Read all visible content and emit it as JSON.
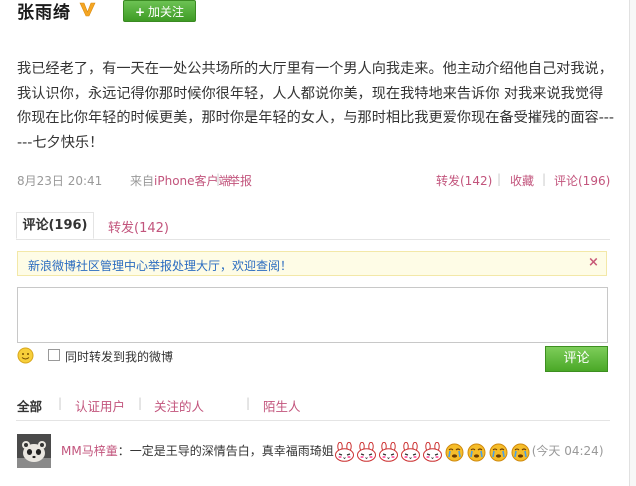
{
  "post": {
    "author": "张雨绮",
    "follow_label": "加关注",
    "follow_plus": "+",
    "text": "我已经老了，有一天在一处公共场所的大厅里有一个男人向我走来。他主动介绍他自己对我说，我认识你，永远记得你那时候你很年轻，人人都说你美，现在我特地来告诉你 对我来说我觉得你现在比你年轻的时候更美，那时你是年轻的女人，与那时相比我更爱你现在备受摧残的面容------七夕快乐！",
    "time": "8月23日 20:41",
    "source_prefix": "来自",
    "source": "iPhone客户端",
    "report": "举报",
    "repost_link": "转发(142)",
    "favorite": "收藏",
    "comment_link": "评论(196)",
    "separator": "|"
  },
  "tabs": {
    "comments": "评论(196)",
    "reposts": "转发(142)"
  },
  "notice": {
    "text": "新浪微博社区管理中心举报处理大厅，欢迎查阅！",
    "close": "×"
  },
  "comment_form": {
    "input_value": "",
    "sync_label": "同时转发到我的微博",
    "submit": "评论"
  },
  "filters": {
    "all": "全部",
    "verified": "认证用户",
    "following": "关注的人",
    "strangers": "陌生人"
  },
  "comments": [
    {
      "user": "MM马梓童",
      "text": "：一定是王导的深情告白，真幸福雨琦姐",
      "time": "(今天 04:24)",
      "emoticons": [
        "rabbit-face",
        "rabbit-face",
        "rabbit-face",
        "rabbit-face",
        "rabbit-face",
        "crying-face",
        "crying-face",
        "crying-face",
        "crying-face"
      ]
    }
  ],
  "colors": {
    "link": "#c2547c",
    "notice_link": "#2b6cc0",
    "button_green": "#4aa827",
    "meta_gray": "#999999"
  }
}
